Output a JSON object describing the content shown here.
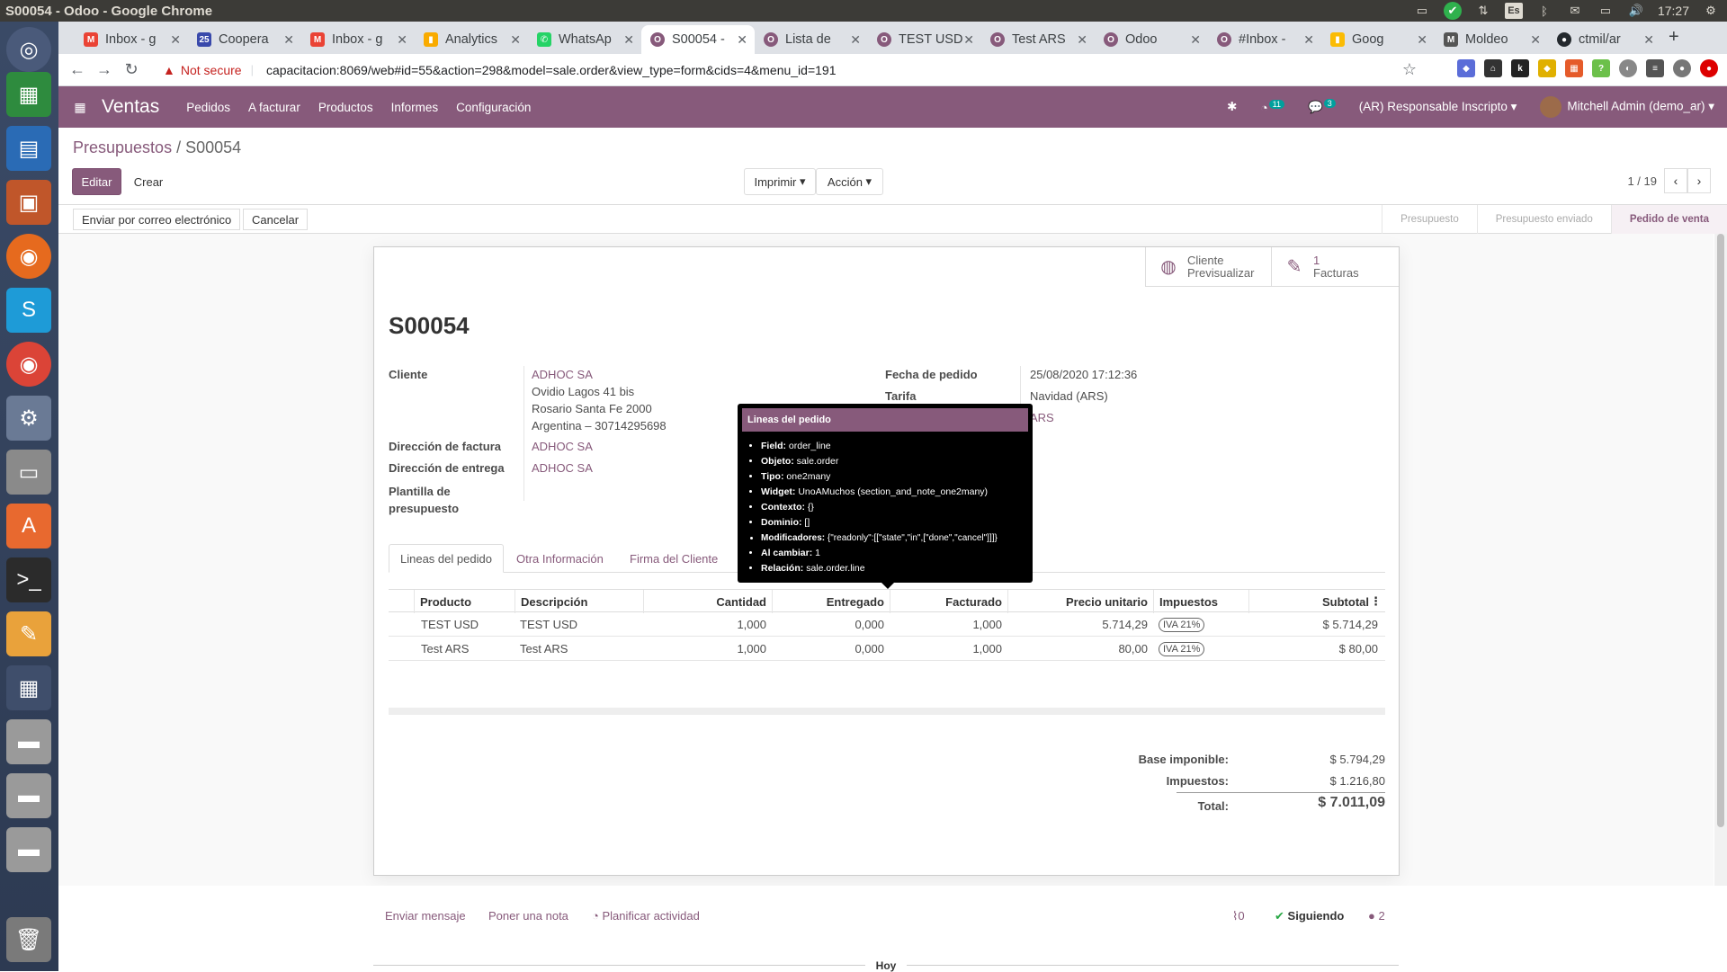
{
  "os": {
    "window_title": "S00054 - Odoo - Google Chrome",
    "clock": "17:27",
    "keyboard": "Es"
  },
  "browser": {
    "tabs": [
      {
        "label": "Inbox - g",
        "icon_color": "#ea4335",
        "icon": "M"
      },
      {
        "label": "Coopera",
        "icon_color": "#3949ab",
        "icon": "25"
      },
      {
        "label": "Inbox - g",
        "icon_color": "#ea4335",
        "icon": "M"
      },
      {
        "label": "Analytics",
        "icon_color": "#f9ab00",
        "icon": "▮"
      },
      {
        "label": "WhatsAp",
        "icon_color": "#25d366",
        "icon": "✆"
      },
      {
        "label": "S00054 - ",
        "icon_color": "#875a7b",
        "icon": "O"
      },
      {
        "label": "Lista de ",
        "icon_color": "#875a7b",
        "icon": "O"
      },
      {
        "label": "TEST USD",
        "icon_color": "#875a7b",
        "icon": "O"
      },
      {
        "label": "Test ARS",
        "icon_color": "#875a7b",
        "icon": "O"
      },
      {
        "label": "Odoo",
        "icon_color": "#875a7b",
        "icon": "O"
      },
      {
        "label": "#Inbox - ",
        "icon_color": "#875a7b",
        "icon": "O"
      },
      {
        "label": "Goog",
        "icon_color": "#fbbc04",
        "icon": "▮"
      },
      {
        "label": "Moldeo",
        "icon_color": "#555",
        "icon": "M"
      },
      {
        "label": "ctmil/ar",
        "icon_color": "#24292e",
        "icon": "●"
      }
    ],
    "security_label": "Not secure",
    "url": "capacitacion:8069/web#id=55&action=298&model=sale.order&view_type=form&cids=4&menu_id=191"
  },
  "navbar": {
    "app_name": "Ventas",
    "menus": [
      "Pedidos",
      "A facturar",
      "Productos",
      "Informes",
      "Configuración"
    ],
    "activity_count": "11",
    "message_count": "3",
    "company": "(AR) Responsable Inscripto",
    "user": "Mitchell Admin (demo_ar)"
  },
  "control_panel": {
    "breadcrumb_parent": "Presupuestos",
    "breadcrumb_sep": " / ",
    "breadcrumb_current": "S00054",
    "edit_label": "Editar",
    "create_label": "Crear",
    "print_label": "Imprimir",
    "action_label": "Acción",
    "pager_value": "1 / 19"
  },
  "statusbar": {
    "send_email_label": "Enviar por correo electrónico",
    "cancel_label": "Cancelar",
    "stages": [
      "Presupuesto",
      "Presupuesto enviado",
      "Pedido de venta"
    ],
    "current_stage": "Pedido de venta"
  },
  "smart_buttons": {
    "preview_line1": "Cliente",
    "preview_line2": "Previsualizar",
    "invoices_count": "1",
    "invoices_label": "Facturas"
  },
  "form": {
    "name": "S00054",
    "customer_label": "Cliente",
    "customer_name": "ADHOC SA",
    "customer_address1": "Ovidio Lagos 41 bis",
    "customer_address2": "Rosario Santa Fe 2000",
    "customer_address3": "Argentina – 30714295698",
    "invoice_address_label": "Dirección de factura",
    "invoice_address": "ADHOC SA",
    "delivery_address_label": "Dirección de entrega",
    "delivery_address": "ADHOC SA",
    "template_label_1": "Plantilla de",
    "template_label_2": "presupuesto",
    "date_label": "Fecha de pedido",
    "date_value": "25/08/2020 17:12:36",
    "pricelist_label": "Tarifa",
    "pricelist_value": "Navidad (ARS)",
    "currency_partial": "ARS"
  },
  "notebook": {
    "tabs": [
      "Lineas del pedido",
      "Otra Información",
      "Firma del Cliente"
    ]
  },
  "lines": {
    "headers": [
      "Producto",
      "Descripción",
      "Cantidad",
      "Entregado",
      "Facturado",
      "Precio unitario",
      "Impuestos",
      "Subtotal"
    ],
    "rows": [
      {
        "product": "TEST USD",
        "description": "TEST USD",
        "qty": "1,000",
        "delivered": "0,000",
        "invoiced": "1,000",
        "price": "5.714,29",
        "tax": "IVA 21%",
        "subtotal": "$ 5.714,29"
      },
      {
        "product": "Test ARS",
        "description": "Test ARS",
        "qty": "1,000",
        "delivered": "0,000",
        "invoiced": "1,000",
        "price": "80,00",
        "tax": "IVA 21%",
        "subtotal": "$ 80,00"
      }
    ]
  },
  "totals": {
    "untaxed_label": "Base imponible:",
    "untaxed_value": "$ 5.794,29",
    "taxes_label": "Impuestos:",
    "taxes_value": "$ 1.216,80",
    "total_label": "Total:",
    "total_value": "$ 7.011,09"
  },
  "tooltip": {
    "title": "Lineas del pedido",
    "items": [
      {
        "key": "Field:",
        "value": "order_line"
      },
      {
        "key": "Objeto:",
        "value": "sale.order"
      },
      {
        "key": "Tipo:",
        "value": "one2many"
      },
      {
        "key": "Widget:",
        "value": "UnoAMuchos (section_and_note_one2many)"
      },
      {
        "key": "Contexto:",
        "value": "{}"
      },
      {
        "key": "Dominio:",
        "value": "[]"
      },
      {
        "key": "Modificadores:",
        "value": "{\"readonly\":[[\"state\",\"in\",[\"done\",\"cancel\"]]]}"
      },
      {
        "key": "Al cambiar:",
        "value": "1"
      },
      {
        "key": "Relación:",
        "value": "sale.order.line"
      }
    ]
  },
  "chatter": {
    "send_message": "Enviar mensaje",
    "log_note": "Poner una nota",
    "schedule_activity": "Planificar actividad",
    "attachments_count": "0",
    "following": "Siguiendo",
    "followers_count": "2",
    "today": "Hoy"
  },
  "colors": {
    "brand": "#875a7b",
    "topbar": "#3c3b37"
  }
}
